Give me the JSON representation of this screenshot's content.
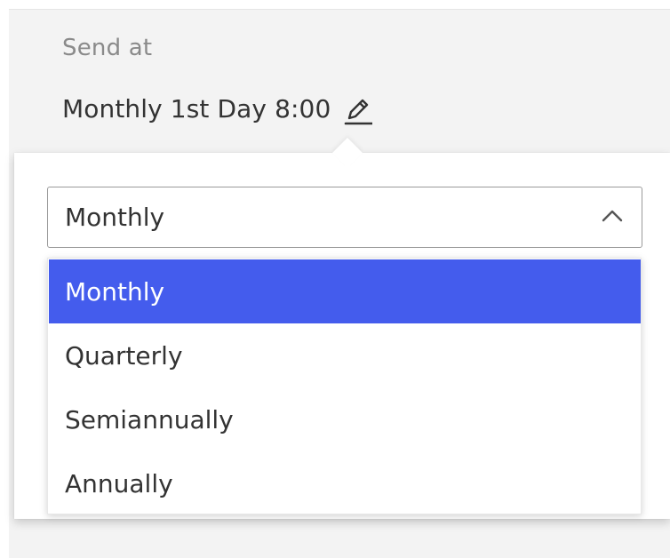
{
  "schedule": {
    "label": "Send at",
    "value_text": "Monthly 1st Day 8:00",
    "edit_icon": "pencil-icon"
  },
  "frequency_select": {
    "selected_value": "Monthly",
    "chevron_icon": "chevron-up-icon",
    "expanded": true,
    "options": [
      {
        "label": "Monthly",
        "selected": true
      },
      {
        "label": "Quarterly",
        "selected": false
      },
      {
        "label": "Semiannually",
        "selected": false
      },
      {
        "label": "Annually",
        "selected": false
      }
    ]
  },
  "colors": {
    "selected_background": "#445ced",
    "selected_text": "#ffffff",
    "panel_background": "#f3f3f3",
    "muted_text": "#8a8a8a",
    "body_text": "#333333"
  }
}
